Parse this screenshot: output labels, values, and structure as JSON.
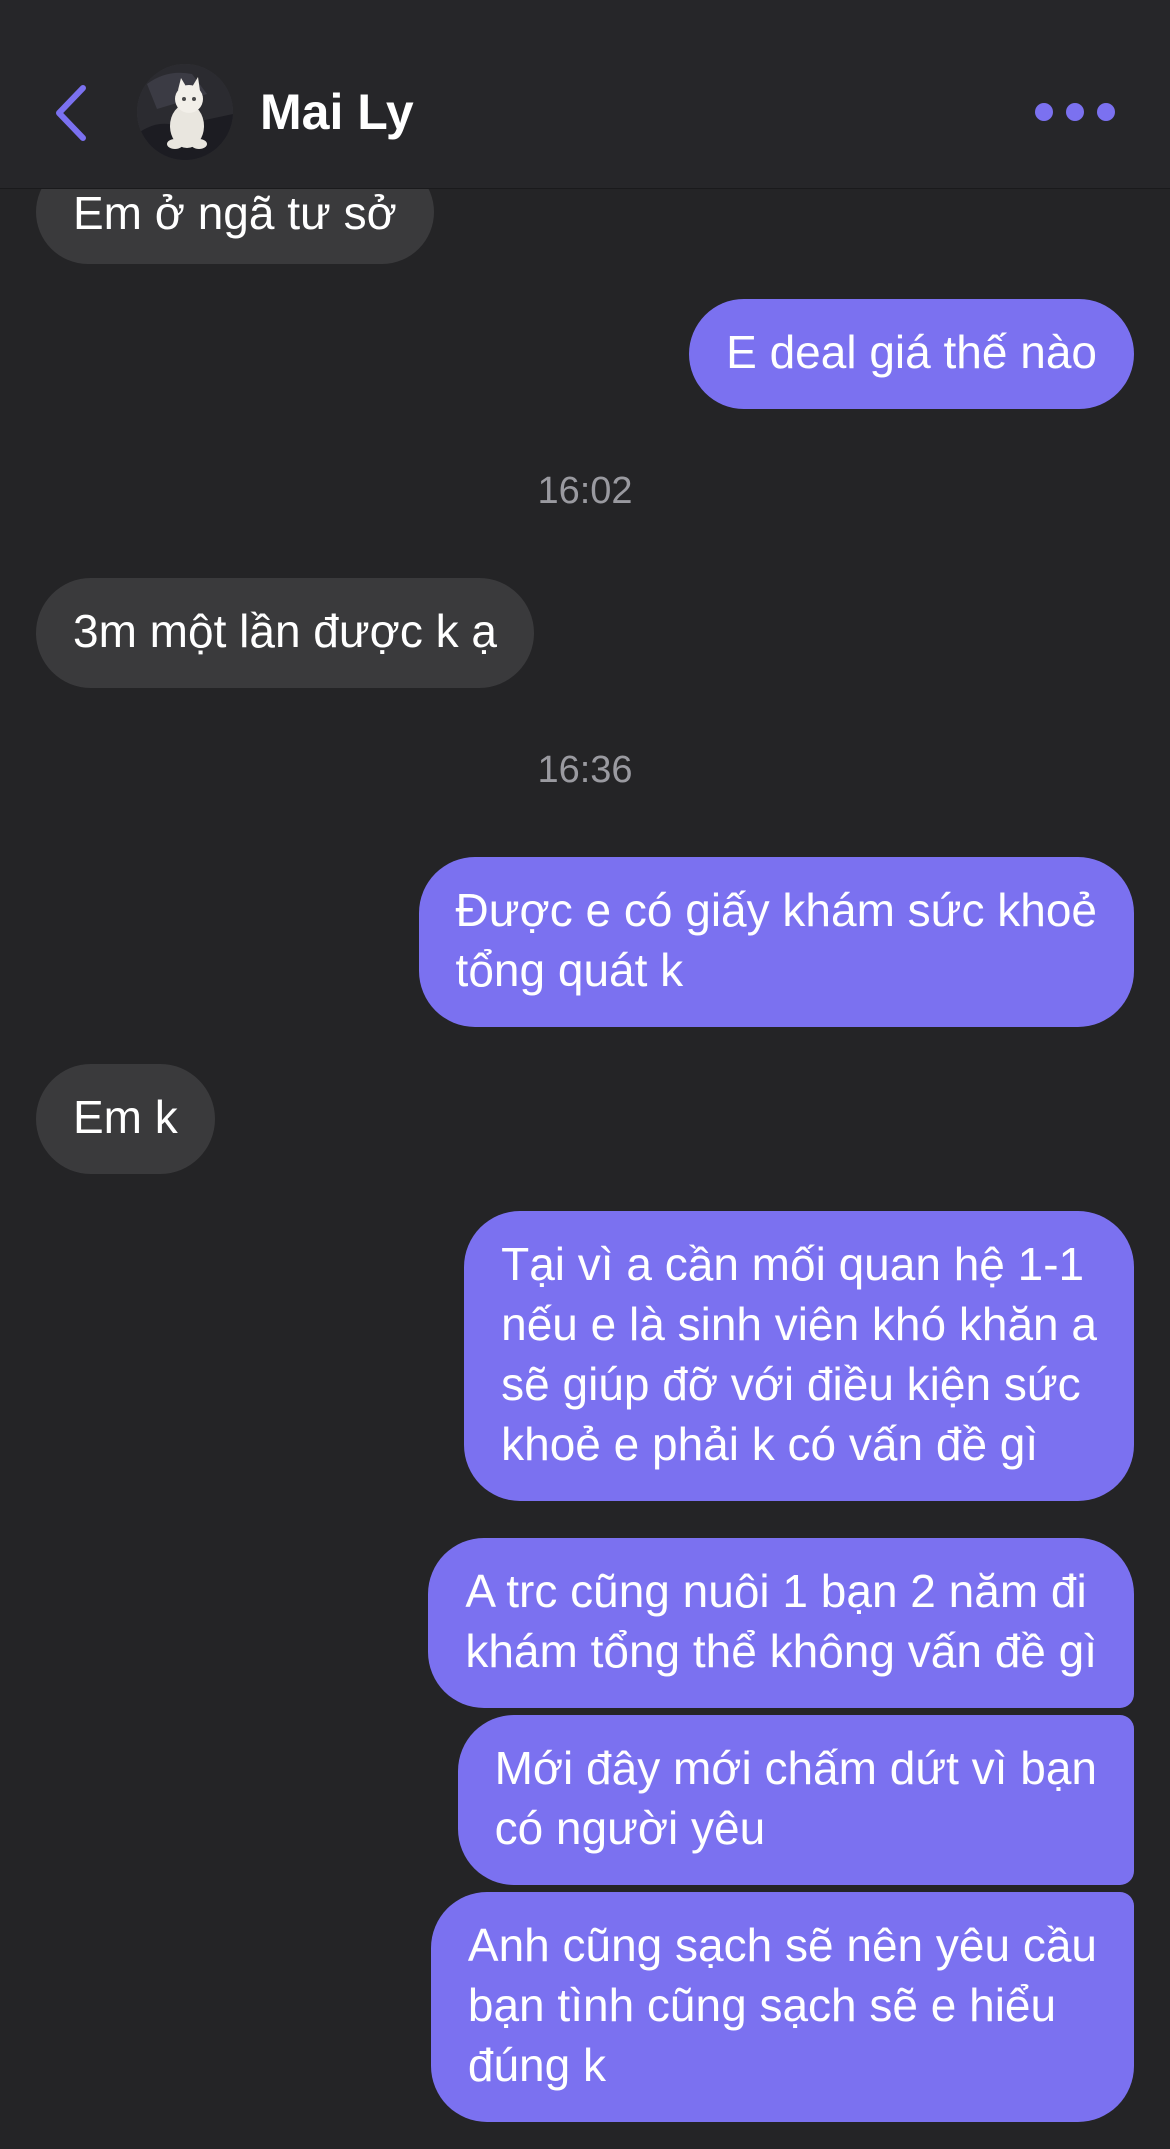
{
  "header": {
    "contact_name": "Mai Ly"
  },
  "colors": {
    "accent": "#7b71f0",
    "incoming_bubble": "#3a3a3c",
    "background": "#242426",
    "timestamp": "#9a9aa0"
  },
  "icons": {
    "back": "chevron-left-icon",
    "more": "more-dots-icon"
  },
  "messages": [
    {
      "direction": "incoming",
      "text": "Em ở ngã tư sở"
    },
    {
      "direction": "outgoing",
      "text": "E deal giá thế nào"
    },
    {
      "type": "timestamp",
      "text": "16:02"
    },
    {
      "direction": "incoming",
      "text": "3m một lần được k ạ"
    },
    {
      "type": "timestamp",
      "text": "16:36"
    },
    {
      "direction": "outgoing",
      "text": "Được e có giấy khám sức khoẻ\ntổng quát k"
    },
    {
      "direction": "incoming",
      "text": "Em k"
    },
    {
      "direction": "outgoing",
      "text": "Tại vì a cần mối quan hệ 1-1\nnếu e là sinh viên khó khăn a\nsẽ giúp đỡ với điều kiện sức\nkhoẻ e phải k có vấn đề gì"
    },
    {
      "direction": "outgoing",
      "text": "A trc cũng nuôi 1 bạn 2 năm đi\nkhám tổng thể không vấn đề gì"
    },
    {
      "direction": "outgoing",
      "text": "Mới đây mới chấm dứt vì bạn\ncó người yêu"
    },
    {
      "direction": "outgoing",
      "text": "Anh cũng sạch sẽ nên yêu cầu\nbạn tình cũng sạch sẽ e hiểu\nđúng k"
    }
  ]
}
